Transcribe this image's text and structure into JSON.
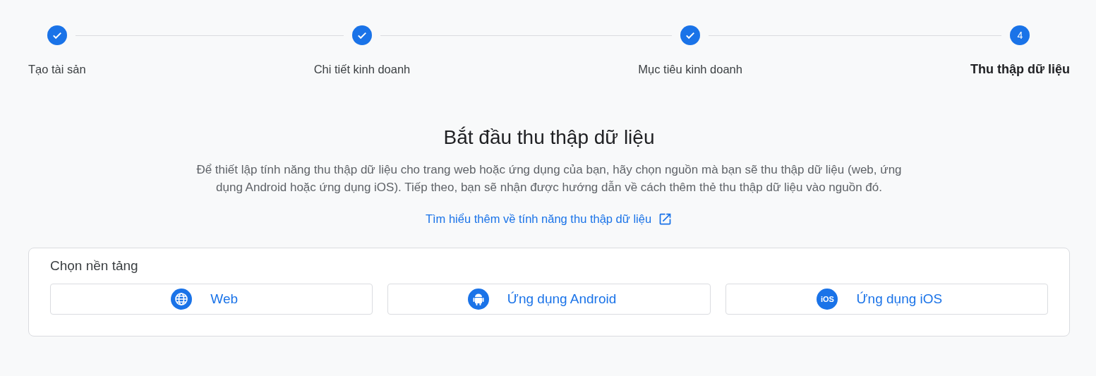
{
  "steps": [
    {
      "label": "Tạo tài sản",
      "completed": true,
      "selected": false
    },
    {
      "label": "Chi tiết kinh doanh",
      "completed": true,
      "selected": false
    },
    {
      "label": "Mục tiêu kinh doanh",
      "completed": true,
      "selected": false
    },
    {
      "label": "Thu thập dữ liệu",
      "number": "4",
      "completed": false,
      "selected": true
    }
  ],
  "heading": "Bắt đầu thu thập dữ liệu",
  "description": "Để thiết lập tính năng thu thập dữ liệu cho trang web hoặc ứng dụng của bạn, hãy chọn nguồn mà bạn sẽ thu thập dữ liệu (web, ứng dụng Android hoặc ứng dụng iOS). Tiếp theo, bạn sẽ nhận được hướng dẫn về cách thêm thẻ thu thập dữ liệu vào nguồn đó.",
  "learn_more_link": "Tìm hiểu thêm về tính năng thu thập dữ liệu",
  "platform_card": {
    "title": "Chọn nền tảng",
    "platforms": [
      {
        "kind": "web",
        "label": "Web"
      },
      {
        "kind": "android",
        "label": "Ứng dụng Android"
      },
      {
        "kind": "ios",
        "label": "Ứng dụng iOS",
        "icon_text": "iOS"
      }
    ]
  }
}
